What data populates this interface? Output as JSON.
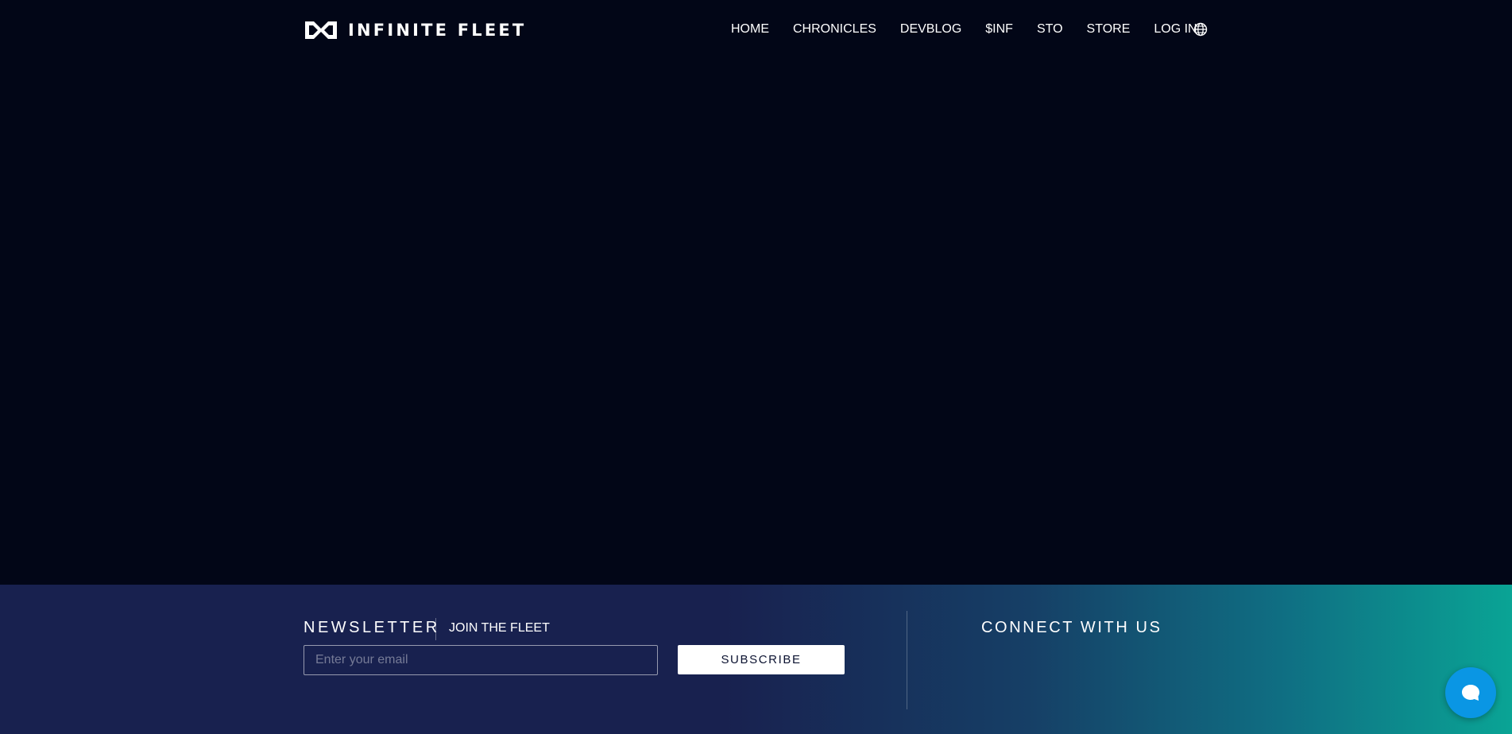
{
  "brand": {
    "logo_icon": "infinite-fleet-logo-icon",
    "name": "INFINITE FLEET"
  },
  "nav": {
    "items": [
      {
        "label": "HOME"
      },
      {
        "label": "CHRONICLES"
      },
      {
        "label": "DEVBLOG"
      },
      {
        "label": "$INF"
      },
      {
        "label": "STO"
      },
      {
        "label": "STORE"
      },
      {
        "label": "LOG IN"
      }
    ],
    "language_icon": "globe-icon"
  },
  "footer": {
    "newsletter": {
      "title": "NEWSLETTER",
      "subtitle": "JOIN THE FLEET",
      "email_placeholder": "Enter your email",
      "subscribe_label": "SUBSCRIBE"
    },
    "connect": {
      "title": "CONNECT WITH US"
    }
  },
  "chat": {
    "icon": "chat-bubble-icon"
  },
  "colors": {
    "background": "#020617",
    "footer_gradient_start": "#18214f",
    "footer_gradient_end": "#0aa495",
    "chat_button": "#0a96e4"
  }
}
